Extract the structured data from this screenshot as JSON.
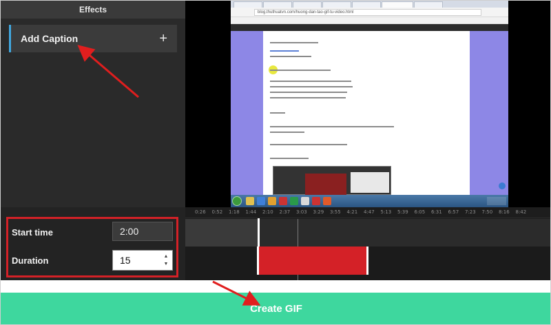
{
  "effects_panel": {
    "header": "Effects",
    "add_caption_label": "Add Caption",
    "add_icon": "+"
  },
  "video_preview": {
    "browser_url": "blog.thuthuatvn.com/huong-dan-tao-gif-tu-video.html"
  },
  "timeline": {
    "ticks": [
      "0:26",
      "0:52",
      "1:18",
      "1:44",
      "2:10",
      "2:37",
      "3:03",
      "3:29",
      "3:55",
      "4:21",
      "4:47",
      "5:13",
      "5:39",
      "6:05",
      "6:31",
      "6:57",
      "7:23",
      "7:50",
      "8:16",
      "8:42"
    ]
  },
  "controls": {
    "start_time_label": "Start time",
    "start_time_value": "2:00",
    "duration_label": "Duration",
    "duration_value": "15"
  },
  "footer": {
    "create_gif_label": "Create GIF"
  },
  "colors": {
    "accent_blue": "#41a8e0",
    "highlight_red": "#d42127",
    "create_button_green": "#3ed79e"
  }
}
